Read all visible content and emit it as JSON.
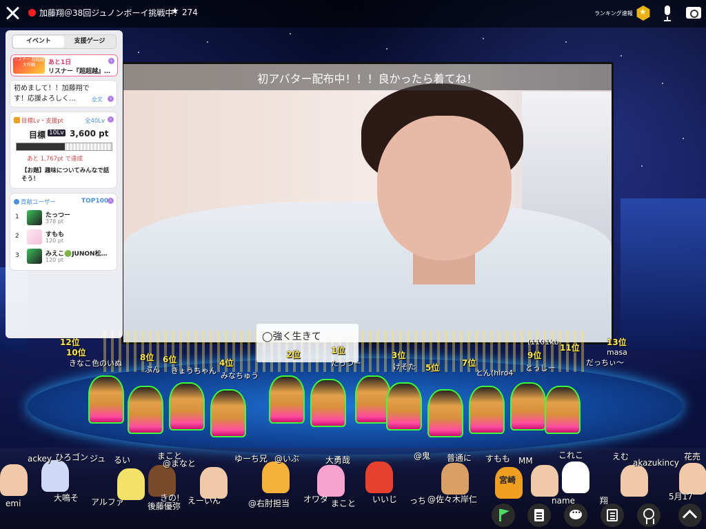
{
  "header": {
    "room_title": "加藤翔＠38回ジュノンボーイ挑戦中！",
    "viewer_count": "274",
    "ranking_label": "ランキング速報"
  },
  "panel": {
    "tabs": [
      "イベント",
      "支援ゲージ"
    ],
    "event": {
      "thumb_text": "リスナー 超超越 大作戦",
      "remaining": "あと1日",
      "name": "リスナー『超超越』…"
    },
    "message": {
      "text": "初めまして！！加藤翔です！応援よろしく…",
      "more": "全文"
    },
    "goal": {
      "header": "目標Lv・支援pt",
      "total": "全40Lv",
      "label": "目標",
      "level": "10Lv",
      "points": "3,600 pt",
      "progress": 0.51,
      "remaining": "あと 1,767pt で達成",
      "topic": "【お題】趣味についてみんなで話そう！"
    },
    "contributors": {
      "header": "貢献ユーザー",
      "top": "TOP100",
      "rows": [
        {
          "rank": "1",
          "name": "たっつー",
          "pt": "378 pt"
        },
        {
          "rank": "2",
          "name": "すもも",
          "pt": "120 pt"
        },
        {
          "rank": "3",
          "name": "みえこ🟢JUNON松…",
          "pt": "120 pt"
        }
      ]
    }
  },
  "video": {
    "caption": "初アバター配布中！！！良かったら着てね！",
    "overlay_text": "◯強く生きて"
  },
  "stage": {
    "ranks": [
      {
        "label": "12位"
      },
      {
        "label": "10位"
      },
      {
        "label": "8位"
      },
      {
        "label": "6位"
      },
      {
        "label": "4位"
      },
      {
        "label": "2位"
      },
      {
        "label": "1位"
      },
      {
        "label": "3位"
      },
      {
        "label": "5位"
      },
      {
        "label": "7位"
      },
      {
        "label": "9位"
      },
      {
        "label": "11位"
      },
      {
        "label": "13位"
      }
    ],
    "names": [
      "きなこ色のいぬ",
      "ぶん",
      "きょうちゃん",
      "みなちゅう",
      "たっつー",
      "けそた",
      "とん(hiro4",
      "とっしー",
      "だっちぃ～",
      "masa",
      "(1101kb"
    ]
  },
  "crowd": {
    "texts": [
      "ackey",
      "ひろゴン",
      "ジュ",
      "るい",
      "まこと",
      "@まなと",
      "ゆーち兄",
      "@いぶ",
      "大勇哉",
      "@鬼",
      "普通に",
      "すもも",
      "MM",
      "これこ",
      "えむ",
      "花売",
      "akazukincy",
      "emi",
      "大鳴そ",
      "アルファ",
      "後藤優弥",
      "きの!",
      "えーいん",
      "@右肘担当",
      "オワタ",
      "まこと",
      "いいじ",
      "っち",
      "@佐々木岸仁",
      "name",
      "翔",
      "5月17"
    ],
    "sign_text": "宮崎"
  },
  "colors": {
    "accent": "#4a8fe0",
    "live": "#ff1e1e",
    "rank": "#ffe94a"
  },
  "controls": [
    "flag-icon",
    "document-icon",
    "chat-icon",
    "list-icon",
    "award-icon",
    "up-chevron-icon"
  ]
}
